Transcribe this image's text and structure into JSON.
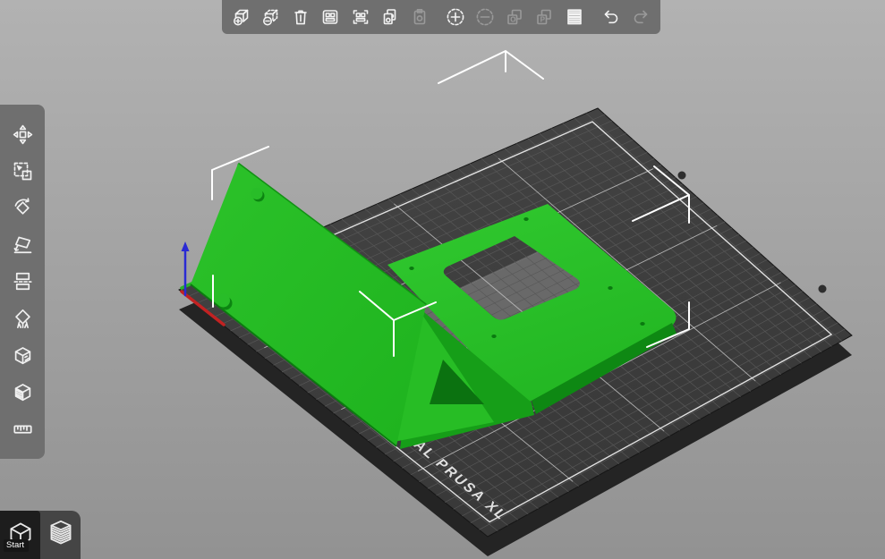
{
  "window": {
    "type": "3d-slicer-editor"
  },
  "colors": {
    "background_top": "#b2b2b2",
    "background_bottom": "#929292",
    "toolbar_bg": "#6f6f6f",
    "icon": "#f3f3f3",
    "bed_surface": "#3d3d3d",
    "bed_center_square": "#696969",
    "bed_base": "#242424",
    "grid_minor": "#585858",
    "grid_major": "#ffffff",
    "model_green": "#2cc22c",
    "model_green_shadow": "#0e8813",
    "selection_marker": "#ffffff",
    "axis_x": "#c22222",
    "axis_y": "#2ab32a",
    "axis_z": "#2a2ad4",
    "active_button_bg": "#1d1d1d"
  },
  "toolbar": {
    "items": [
      {
        "name": "add-object-icon",
        "enabled": true
      },
      {
        "name": "delete-object-icon",
        "enabled": true
      },
      {
        "name": "delete-all-icon",
        "enabled": true
      },
      {
        "name": "arrange-icon",
        "enabled": true
      },
      {
        "name": "arrange-selection-icon",
        "enabled": true
      },
      {
        "name": "copy-icon",
        "enabled": true
      },
      {
        "name": "paste-icon",
        "enabled": false
      },
      {
        "name": "add-instance-icon",
        "enabled": true
      },
      {
        "name": "remove-instance-icon",
        "enabled": false
      },
      {
        "name": "split-to-objects-icon",
        "enabled": false
      },
      {
        "name": "split-to-parts-icon",
        "enabled": false
      },
      {
        "name": "variable-layer-height-icon",
        "enabled": true
      },
      {
        "name": "undo-icon",
        "enabled": true
      },
      {
        "name": "redo-icon",
        "enabled": false
      }
    ]
  },
  "sidebar": {
    "tools": [
      {
        "name": "move-tool-icon"
      },
      {
        "name": "scale-tool-icon"
      },
      {
        "name": "rotate-tool-icon"
      },
      {
        "name": "place-on-face-tool-icon"
      },
      {
        "name": "cut-tool-icon"
      },
      {
        "name": "paint-supports-tool-icon"
      },
      {
        "name": "seam-painting-tool-icon"
      },
      {
        "name": "multimaterial-painting-tool-icon"
      },
      {
        "name": "measure-tool-icon"
      }
    ]
  },
  "view_switcher": {
    "buttons": [
      {
        "name": "editor-view-button",
        "icon": "cube-wireframe-icon",
        "label": "Start",
        "active": true
      },
      {
        "name": "preview-view-button",
        "icon": "layers-stack-icon",
        "label": "",
        "active": false
      }
    ]
  },
  "viewport": {
    "bed_label": "NAL PRUSA XL",
    "selected_model": "green-bracket",
    "axes": [
      "x-red",
      "y-green",
      "z-blue"
    ]
  }
}
